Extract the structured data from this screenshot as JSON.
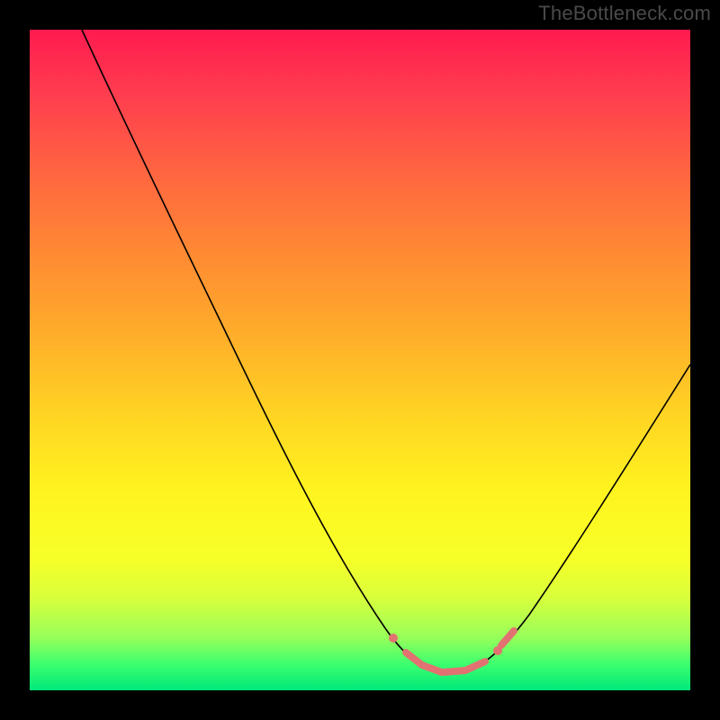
{
  "attribution": "TheBottleneck.com",
  "colors": {
    "background": "#000000",
    "gradient_top": "#ff1a4f",
    "gradient_bottom": "#00e87a",
    "curve": "#000000",
    "marker": "#e27272"
  },
  "chart_data": {
    "type": "line",
    "title": "",
    "xlabel": "",
    "ylabel": "",
    "xlim": [
      0,
      100
    ],
    "ylim": [
      0,
      100
    ],
    "series": [
      {
        "name": "bottleneck-curve",
        "x": [
          8,
          15,
          25,
          35,
          45,
          52,
          56,
          60,
          64,
          67,
          70,
          75,
          82,
          90,
          100
        ],
        "y": [
          100,
          88,
          70,
          52,
          33,
          20,
          10,
          4,
          2,
          2,
          4,
          10,
          22,
          38,
          58
        ]
      }
    ],
    "markers": {
      "name": "optimal-range",
      "x": [
        56,
        58,
        60,
        62,
        64,
        66,
        68,
        70
      ],
      "y": [
        6,
        4,
        3,
        2,
        2,
        3,
        4,
        6
      ]
    }
  }
}
